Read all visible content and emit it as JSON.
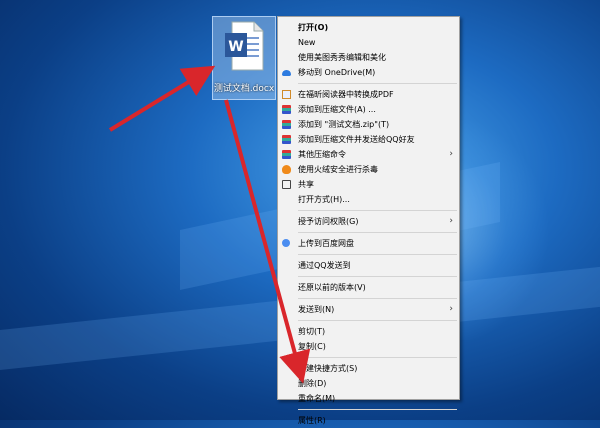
{
  "desktop": {
    "file_icon_name": "word-doc-icon",
    "file_label": "测试文档.docx",
    "accent": "#d9262b"
  },
  "context_menu": {
    "groups": [
      [
        {
          "label": "打开(O)",
          "bold": true
        },
        {
          "label": "New"
        },
        {
          "label": "使用美图秀秀编辑和美化"
        },
        {
          "label": "移动到 OneDrive(M)",
          "icon": "onedrive-cloud-icon"
        }
      ],
      [
        {
          "label": "在福昕阅读器中转换成PDF",
          "icon": "pdf-icon"
        },
        {
          "label": "添加到压缩文件(A) ...",
          "icon": "winrar-icon"
        },
        {
          "label": "添加到 \"测试文档.zip\"(T)",
          "icon": "winrar-icon"
        },
        {
          "label": "添加到压缩文件并发送给QQ好友",
          "icon": "winrar-icon"
        },
        {
          "label": "其他压缩命令",
          "icon": "winrar-icon",
          "submenu": true
        },
        {
          "label": "使用火绒安全进行杀毒",
          "icon": "huorong-icon"
        },
        {
          "label": "共享",
          "icon": "share-icon"
        },
        {
          "label": "打开方式(H)..."
        }
      ],
      [
        {
          "label": "授予访问权限(G)",
          "submenu": true
        }
      ],
      [
        {
          "label": "上传到百度网盘",
          "icon": "baidu-netdisk-icon"
        }
      ],
      [
        {
          "label": "通过QQ发送到"
        }
      ],
      [
        {
          "label": "还原以前的版本(V)"
        }
      ],
      [
        {
          "label": "发送到(N)",
          "submenu": true
        }
      ],
      [
        {
          "label": "剪切(T)"
        },
        {
          "label": "复制(C)"
        }
      ],
      [
        {
          "label": "创建快捷方式(S)"
        },
        {
          "label": "删除(D)"
        },
        {
          "label": "重命名(M)"
        }
      ],
      [
        {
          "label": "属性(R)"
        }
      ]
    ]
  }
}
